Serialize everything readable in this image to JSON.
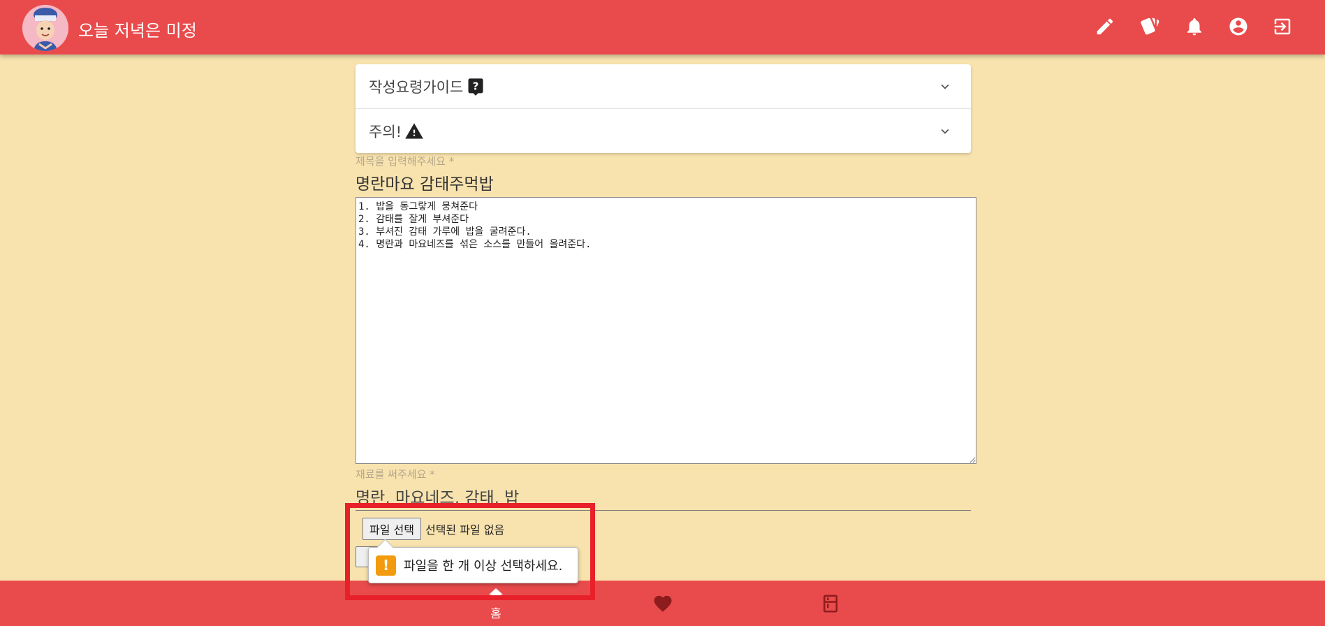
{
  "app": {
    "title": "오늘 저녁은 미정"
  },
  "header_icons": [
    "pencil-icon",
    "cards-icon",
    "bell-icon",
    "account-icon",
    "logout-icon"
  ],
  "accordion": {
    "items": [
      {
        "label": "작성요령가이드",
        "icon": "question-icon"
      },
      {
        "label": "주의!",
        "icon": "warning-icon"
      }
    ]
  },
  "form": {
    "title_label": "제목을 입력해주세요 *",
    "title_value": "명란마요 감태주먹밥",
    "content_value": "1. 밥을 동그랗게 뭉쳐준다\n2. 감태를 잘게 부셔준다\n3. 부셔진 감태 가루에 밥을 굴려준다.\n4. 명란과 마요네즈를 섞은 소스를 만들어 올려준다.",
    "ingredients_label": "재료를 써주세요 *",
    "ingredients_value": "명란, 마요네즈, 감태, 밥",
    "file_button": "파일 선택",
    "file_status": "선택된 파일 없음",
    "validation_message": "파일을 한 개 이상 선택하세요."
  },
  "bottom_nav": {
    "home_label": "홈",
    "items": [
      "home-icon",
      "heart-icon",
      "fridge-icon"
    ]
  },
  "colors": {
    "primary": "#e94b4c",
    "background": "#f8e3ae",
    "warning": "#f29b0f",
    "highlight": "#e8202a"
  }
}
